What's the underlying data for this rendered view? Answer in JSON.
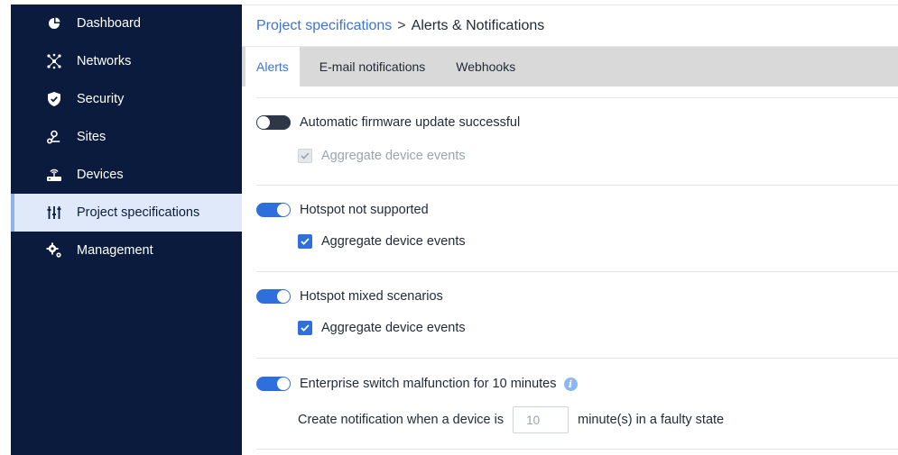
{
  "sidebar": {
    "items": [
      {
        "label": "Dashboard",
        "icon": "dashboard-gauge-icon",
        "active": false
      },
      {
        "label": "Networks",
        "icon": "networks-icon",
        "active": false
      },
      {
        "label": "Security",
        "icon": "shield-icon",
        "active": false
      },
      {
        "label": "Sites",
        "icon": "sites-icon",
        "active": false
      },
      {
        "label": "Devices",
        "icon": "router-icon",
        "active": false
      },
      {
        "label": "Project specifications",
        "icon": "sliders-icon",
        "active": true
      },
      {
        "label": "Management",
        "icon": "gears-icon",
        "active": false
      }
    ]
  },
  "breadcrumb": {
    "parent": "Project specifications",
    "separator": ">",
    "current": "Alerts & Notifications"
  },
  "tabs": [
    {
      "label": "Alerts",
      "active": true
    },
    {
      "label": "E-mail notifications",
      "active": false
    },
    {
      "label": "Webhooks",
      "active": false
    }
  ],
  "alerts": [
    {
      "label": "Automatic firmware update successful",
      "enabled": false,
      "aggregate_label": "Aggregate device events",
      "aggregate_checked": true,
      "aggregate_disabled": true
    },
    {
      "label": "Hotspot not supported",
      "enabled": true,
      "aggregate_label": "Aggregate device events",
      "aggregate_checked": true,
      "aggregate_disabled": false
    },
    {
      "label": "Hotspot mixed scenarios",
      "enabled": true,
      "aggregate_label": "Aggregate device events",
      "aggregate_checked": true,
      "aggregate_disabled": false
    },
    {
      "label": "Enterprise switch malfunction for 10 minutes",
      "enabled": true,
      "info_icon": "info-icon",
      "notify_prefix": "Create notification when a device is",
      "notify_value": "10",
      "notify_suffix": "minute(s) in a faulty state"
    }
  ],
  "colors": {
    "sidebar_bg": "#0b1b3d",
    "accent": "#2f6fdc",
    "link": "#3b73d8",
    "tab_bar": "#d9d9d9",
    "active_nav_bg": "#dfe9f9"
  }
}
